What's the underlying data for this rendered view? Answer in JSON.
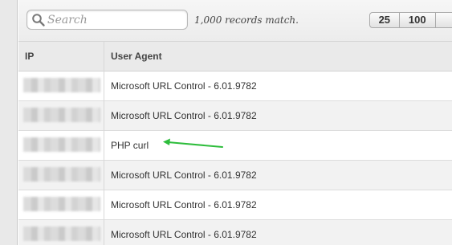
{
  "search": {
    "placeholder": "Search"
  },
  "records": {
    "count_text": "1,000 records match."
  },
  "pagination": {
    "options": [
      "25",
      "100",
      ""
    ]
  },
  "table": {
    "columns": [
      "IP",
      "User Agent"
    ],
    "rows": [
      {
        "ip": "",
        "user_agent": "Microsoft URL Control - 6.01.9782"
      },
      {
        "ip": "",
        "user_agent": "Microsoft URL Control - 6.01.9782"
      },
      {
        "ip": "",
        "user_agent": "PHP curl"
      },
      {
        "ip": "",
        "user_agent": "Microsoft URL Control - 6.01.9782"
      },
      {
        "ip": "",
        "user_agent": "Microsoft URL Control - 6.01.9782"
      },
      {
        "ip": "",
        "user_agent": "Microsoft URL Control - 6.01.9782"
      }
    ]
  },
  "annotation": {
    "color": "#2ebd3c",
    "icon": "arrow-left-icon"
  },
  "colors": {
    "row_alt": "#f2f2f2",
    "header_bg": "#eaeaea"
  }
}
